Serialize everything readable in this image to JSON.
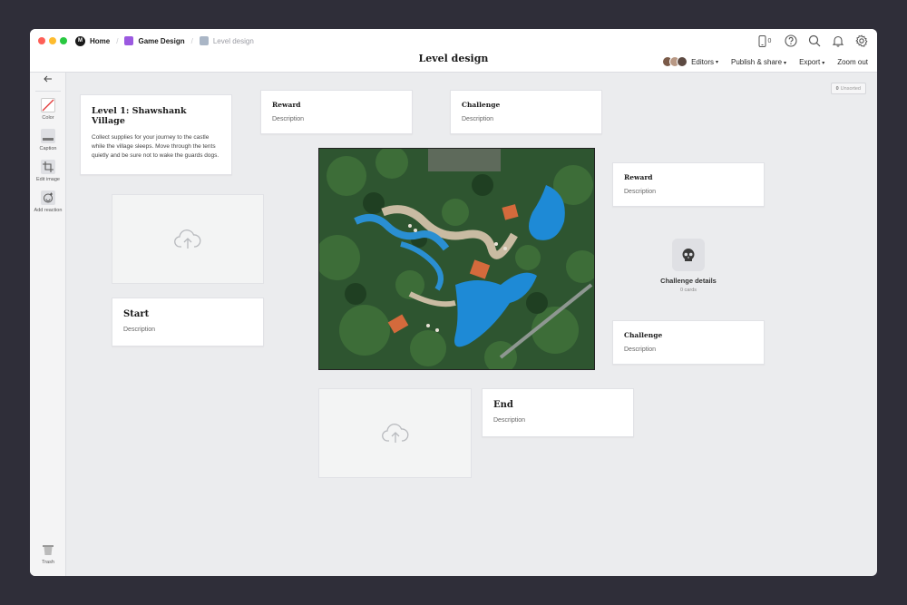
{
  "breadcrumbs": [
    {
      "label": "Home",
      "color": "#1a1a1a"
    },
    {
      "label": "Game Design",
      "color": "#9b59e0"
    },
    {
      "label": "Level design",
      "color": "#aab6c6"
    }
  ],
  "page_title": "Level design",
  "notification_count": "0",
  "toolbar": {
    "editors": "Editors",
    "publish": "Publish & share",
    "export": "Export",
    "zoom": "Zoom out"
  },
  "sidebar": {
    "back_icon": "arrow-left-icon",
    "items": [
      {
        "label": "Color",
        "icon": "color-slash-icon"
      },
      {
        "label": "Caption",
        "icon": "caption-icon"
      },
      {
        "label": "Edit image",
        "icon": "crop-icon"
      },
      {
        "label": "Add reaction",
        "icon": "smiley-plus-icon"
      }
    ],
    "trash": "Trash"
  },
  "unsorted": {
    "count": "0",
    "label": "Unsorted"
  },
  "cards": {
    "intro": {
      "title": "Level 1: Shawshank Village",
      "body": "Collect supplies for your journey to the castle while the village sleeps. Move through the tents quietly and be sure not to wake the guards dogs."
    },
    "reward_top": {
      "title": "Reward",
      "desc": "Description"
    },
    "challenge_top": {
      "title": "Challenge",
      "desc": "Description"
    },
    "reward_right": {
      "title": "Reward",
      "desc": "Description"
    },
    "start": {
      "title": "Start",
      "desc": "Description"
    },
    "challenge_right": {
      "title": "Challenge",
      "desc": "Description"
    },
    "end": {
      "title": "End",
      "desc": "Description"
    }
  },
  "board": {
    "title": "Challenge details",
    "count": "0 cards",
    "icon": "skull-icon"
  },
  "colors": {
    "accent_game": "#9b59e0",
    "accent_level": "#aab6c6",
    "canvas": "#ebecee"
  }
}
